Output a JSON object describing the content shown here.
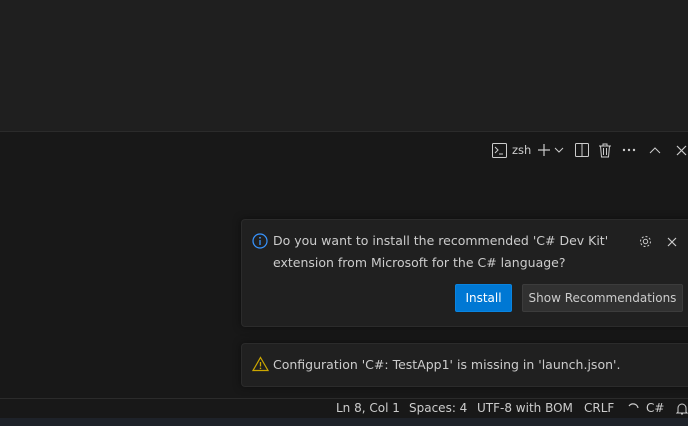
{
  "panel_toolbar": {
    "terminal_name": "zsh"
  },
  "notifications": [
    {
      "type": "info",
      "message_line1": "Do you want to install the recommended 'C# Dev Kit'",
      "message_line2": "extension from Microsoft for the C# language?",
      "primary_button": "Install",
      "secondary_button": "Show Recommendations"
    },
    {
      "type": "warning",
      "message": "Configuration 'C#: TestApp1' is missing in 'launch.json'."
    }
  ],
  "status_bar": {
    "position": "Ln 8, Col 1",
    "indent": "Spaces: 4",
    "encoding": "UTF-8 with BOM",
    "eol": "CRLF",
    "language": "C#"
  },
  "colors": {
    "accent": "#0078d4",
    "info": "#3794ff",
    "warning": "#cca700"
  }
}
